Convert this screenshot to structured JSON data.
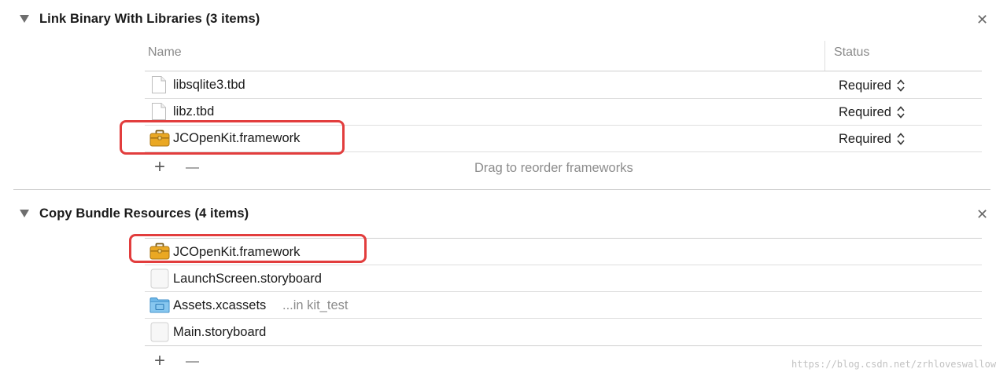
{
  "link_section": {
    "title": "Link Binary With Libraries (3 items)",
    "col_name": "Name",
    "col_status": "Status",
    "rows": [
      {
        "name": "libsqlite3.tbd",
        "icon": "file-icon",
        "status": "Required"
      },
      {
        "name": "libz.tbd",
        "icon": "file-icon",
        "status": "Required"
      },
      {
        "name": "JCOpenKit.framework",
        "icon": "toolbox-icon",
        "status": "Required"
      }
    ],
    "add_symbol": "+",
    "drag_hint": "Drag to reorder frameworks"
  },
  "copy_section": {
    "title": "Copy Bundle Resources (4 items)",
    "rows": [
      {
        "name": "JCOpenKit.framework",
        "icon": "toolbox-icon",
        "path": ""
      },
      {
        "name": "LaunchScreen.storyboard",
        "icon": "storyboard-icon",
        "path": ""
      },
      {
        "name": "Assets.xcassets",
        "icon": "folder-icon",
        "path": "...in kit_test"
      },
      {
        "name": "Main.storyboard",
        "icon": "storyboard-icon",
        "path": ""
      }
    ],
    "add_symbol": "+"
  },
  "close_symbol": "✕",
  "watermark": "https://blog.csdn.net/zrhloveswallow",
  "colors": {
    "highlight_border": "#e23d3d",
    "framework_icon": "#e6a520",
    "folder_icon": "#6fb8e8"
  }
}
